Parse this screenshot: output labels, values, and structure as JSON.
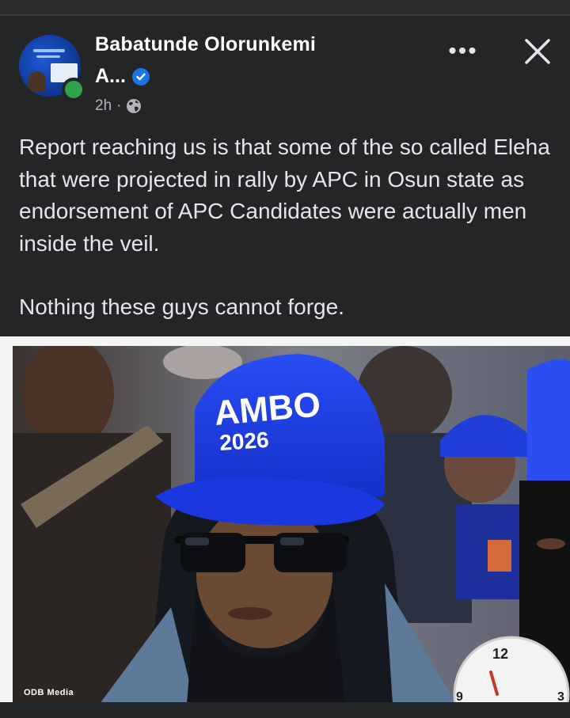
{
  "post": {
    "author_line1": "Babatunde Olorunkemi",
    "author_line2": "A...",
    "time": "2h",
    "separator": "·",
    "more_label": "•••",
    "paragraph1": "Report reaching us is that some of the so called Eleha that were projected in rally by APC in Osun state as endorsement of APC Candidates were actually men inside the veil.",
    "paragraph2": "Nothing these guys cannot forge."
  },
  "photo": {
    "cap_line1": "AMBO",
    "cap_line2": "2026",
    "watermark": "ODB Media",
    "clock_12": "12",
    "clock_3": "3",
    "clock_9": "9"
  },
  "icons": {
    "verified": "verified-badge-icon",
    "globe": "globe-icon",
    "more": "more-options-icon",
    "close": "close-icon"
  },
  "colors": {
    "background": "#242526",
    "text": "#e4e6eb",
    "verified_blue": "#1b74e4",
    "online_green": "#31a24c",
    "cap_blue": "#1c3ef0"
  }
}
